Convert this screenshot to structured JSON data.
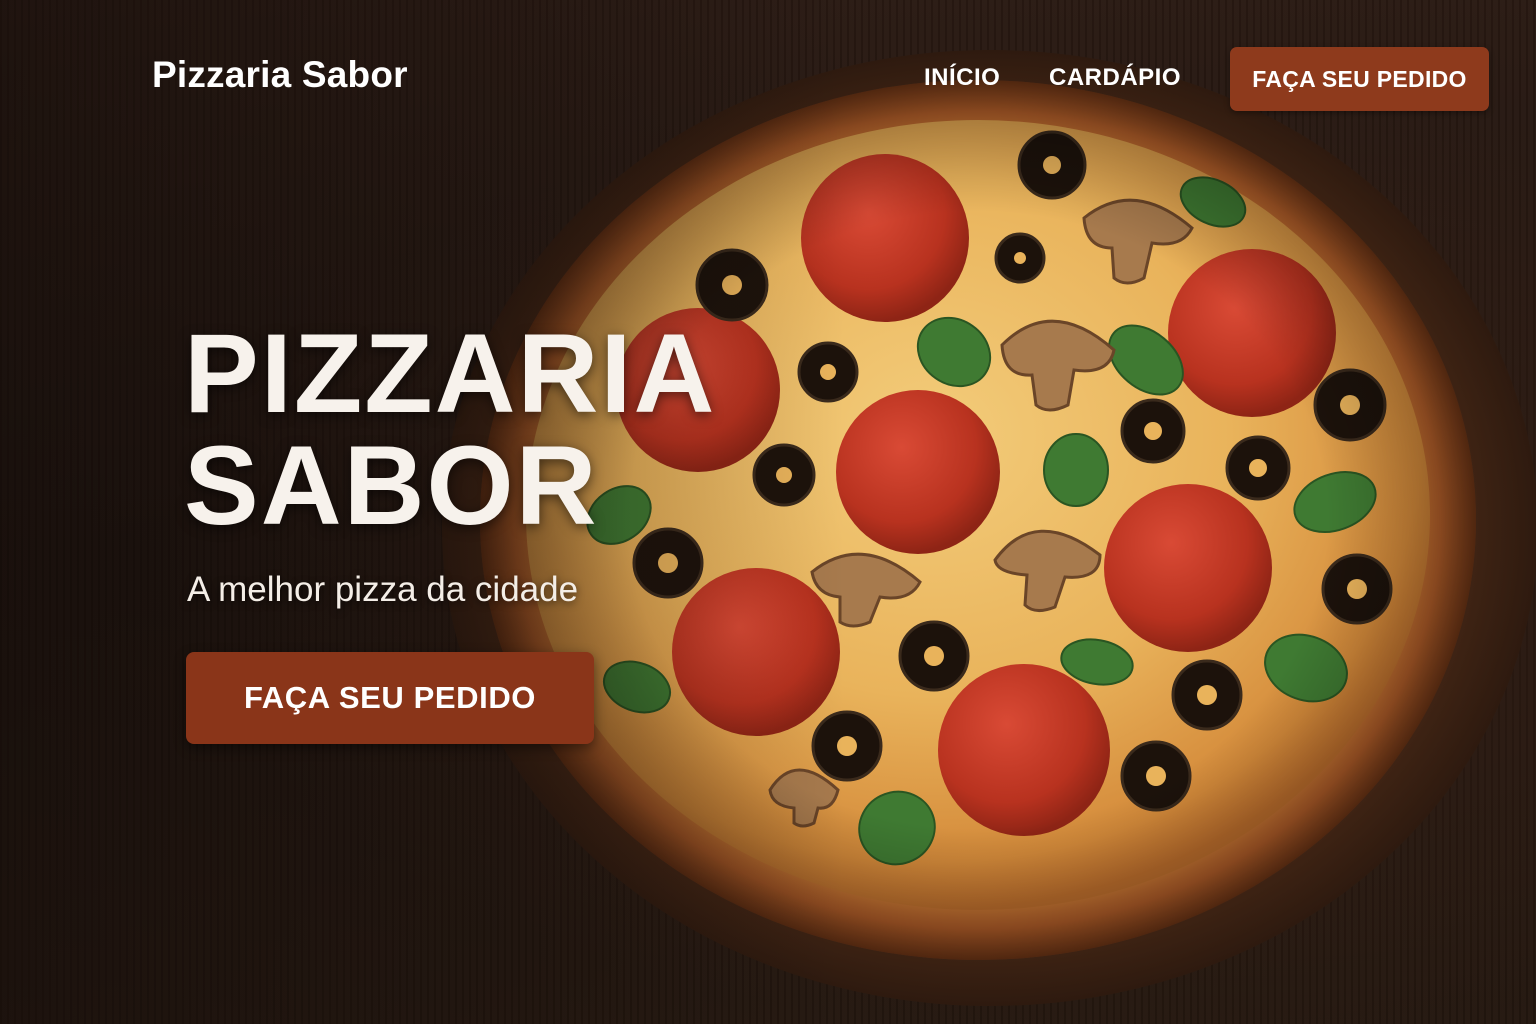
{
  "nav": {
    "brand": "Pizzaria Sabor",
    "links": [
      {
        "label": "INÍCIO"
      },
      {
        "label": "CARDÁPIO"
      }
    ],
    "cta_label": "FAÇA SEU PEDIDO"
  },
  "hero": {
    "title_line1": "PIZZARIA",
    "title_line2": "SABOR",
    "subtitle": "A melhor pizza da cidade",
    "cta_label": "FAÇA SEU PEDIDO",
    "image_icon": "pizza-icon"
  },
  "colors": {
    "accent": "#8e3a1c",
    "background": "#1f1410",
    "text": "#ffffff"
  }
}
